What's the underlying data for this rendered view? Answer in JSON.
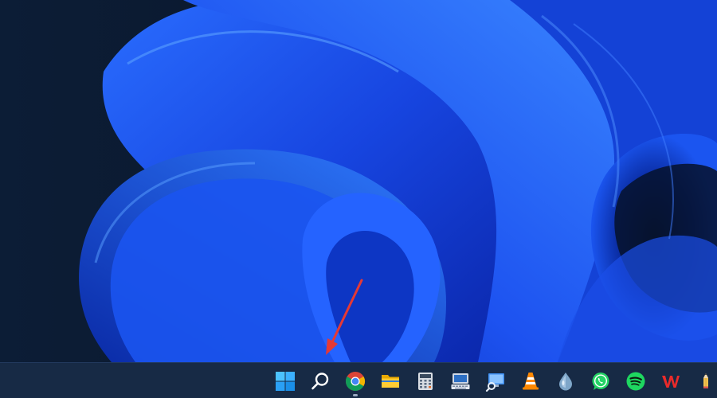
{
  "desktop": {
    "wallpaper": {
      "background_color": "#0b1a33",
      "accent_colors": [
        "#0a2fb8",
        "#1f5cff",
        "#2f7bff",
        "#69a7ff"
      ]
    },
    "annotation": {
      "type": "red-arrow",
      "color": "#e53935",
      "target": "windows-search-icon"
    }
  },
  "taskbar": {
    "background": "#172a45",
    "apps": [
      {
        "id": "start",
        "icon": "windows-start-icon",
        "running": false
      },
      {
        "id": "search",
        "icon": "search-icon",
        "running": false
      },
      {
        "id": "chrome",
        "icon": "chrome-icon",
        "running": true
      },
      {
        "id": "file-explorer",
        "icon": "folder-icon",
        "running": false
      },
      {
        "id": "calculator",
        "icon": "calculator-icon",
        "running": false
      },
      {
        "id": "keyboard-tool",
        "icon": "keyboard-app-icon",
        "running": false
      },
      {
        "id": "remote-desktop",
        "icon": "monitor-search-icon",
        "running": false
      },
      {
        "id": "vlc",
        "icon": "vlc-cone-icon",
        "running": false
      },
      {
        "id": "droplet-app",
        "icon": "droplet-icon",
        "running": false
      },
      {
        "id": "whatsapp",
        "icon": "whatsapp-icon",
        "running": false
      },
      {
        "id": "spotify",
        "icon": "spotify-icon",
        "running": false
      },
      {
        "id": "wps-office",
        "icon": "wps-office-icon",
        "running": false
      },
      {
        "id": "pencil-app",
        "icon": "pencil-icon",
        "running": false
      }
    ]
  }
}
